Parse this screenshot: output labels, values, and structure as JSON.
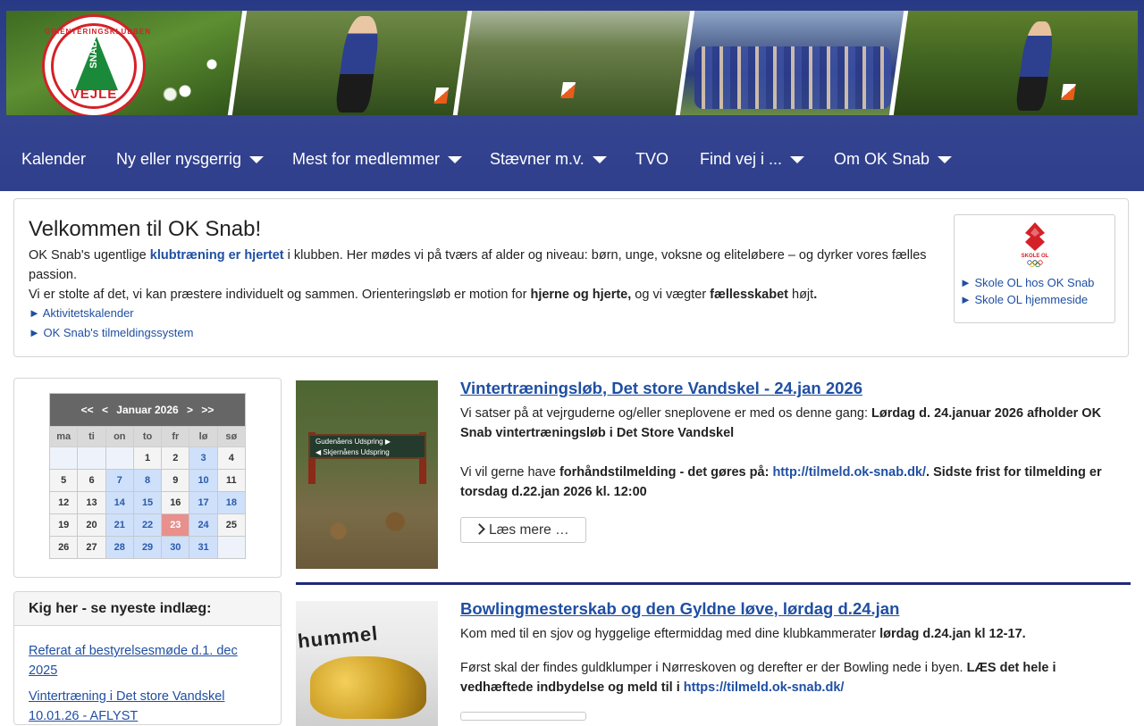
{
  "logo": {
    "top_text": "ORIENTERINGSKLUBBEN",
    "mid_text": "SNAB",
    "bottom_text": "VEJLE"
  },
  "nav": [
    {
      "label": "Kalender",
      "dropdown": false
    },
    {
      "label": "Ny eller nysgerrig",
      "dropdown": true
    },
    {
      "label": "Mest for medlemmer",
      "dropdown": true
    },
    {
      "label": "Stævner m.v.",
      "dropdown": true
    },
    {
      "label": "TVO",
      "dropdown": false
    },
    {
      "label": "Find vej i ...",
      "dropdown": true
    },
    {
      "label": "Om OK Snab",
      "dropdown": true
    }
  ],
  "welcome": {
    "title": "Velkommen til OK Snab!",
    "p1_a": "OK Snab's ugentlige ",
    "p1_link": "klubtræning er hjertet",
    "p1_b": " i klubben. Her mødes vi på tværs af alder og niveau: børn, unge, voksne og eliteløbere – og dyrker vores fælles passion.",
    "p2_a": "Vi er stolte af det, vi kan præstere individuelt og sammen. Orienteringsløb er motion for ",
    "p2_b1": "hjerne og hjerte,",
    "p2_c": " og vi vægter ",
    "p2_b2": "fællesskabet",
    "p2_d": " højt",
    "p2_e": ".",
    "links": [
      "► Aktivitetskalender",
      "► OK Snab's tilmeldingssystem"
    ]
  },
  "skole": {
    "logo_text": "SKOLE OL",
    "links": [
      "► Skole OL hos OK Snab",
      "► Skole OL hjemmeside"
    ]
  },
  "calendar": {
    "nav_prev_year": "<<",
    "nav_prev": "<",
    "month": "Januar 2026",
    "nav_next": ">",
    "nav_next_year": ">>",
    "weekdays": [
      "ma",
      "ti",
      "on",
      "to",
      "fr",
      "lø",
      "sø"
    ],
    "rows": [
      [
        "",
        "",
        "",
        "1",
        "2",
        "3",
        "4"
      ],
      [
        "5",
        "6",
        "7",
        "8",
        "9",
        "10",
        "11"
      ],
      [
        "12",
        "13",
        "14",
        "15",
        "16",
        "17",
        "18"
      ],
      [
        "19",
        "20",
        "21",
        "22",
        "23",
        "24",
        "25"
      ],
      [
        "26",
        "27",
        "28",
        "29",
        "30",
        "31",
        ""
      ]
    ]
  },
  "latest": {
    "title": "Kig her - se nyeste indlæg:",
    "posts": [
      "Referat af bestyrelsesmøde d.1. dec 2025",
      "Vintertræning i Det store Vandskel 10.01.26 - AFLYST"
    ]
  },
  "articles": [
    {
      "title": "Vintertræningsløb, Det store Vandskel - 24.jan 2026",
      "t1": "Vi satser på at vejrguderne og/eller sneplovene er med os denne gang: ",
      "t1b": "Lørdag d. 24.januar 2026 afholder OK Snab vintertræningsløb i Det Store Vandskel",
      "t2": "Vi vil gerne have ",
      "t2b": "forhåndstilmelding - det gøres på: ",
      "t2link": "http://tilmeld.ok-snab.dk/",
      "t2c": ". Sidste frist for tilmelding er torsdag d.22.jan 2026 kl. 12:00",
      "sign1": "Gudenåens Udspring ▶",
      "sign2": "◀ Skjernåens Udspring",
      "more": "Læs mere …"
    },
    {
      "title": "Bowlingmesterskab og den Gyldne løve, lørdag d.24.jan",
      "t1": "Kom med til en sjov og hyggelige eftermiddag med dine klubkammerater ",
      "t1b": "lørdag d.24.jan  kl 12-17.",
      "t2": "Først skal der findes guldklumper i Nørreskoven og derefter er der Bowling nede i byen. ",
      "t2b": "LÆS det hele i vedhæftede indbydelse og meld til i ",
      "t2link": "https://tilmeld.ok-snab.dk/",
      "brand": "hummel"
    }
  ],
  "colors": {
    "nav_bg": "#2f3f8c",
    "link": "#1f4fa3",
    "today": "#e8908c",
    "event_day": "#cfe0fb"
  }
}
